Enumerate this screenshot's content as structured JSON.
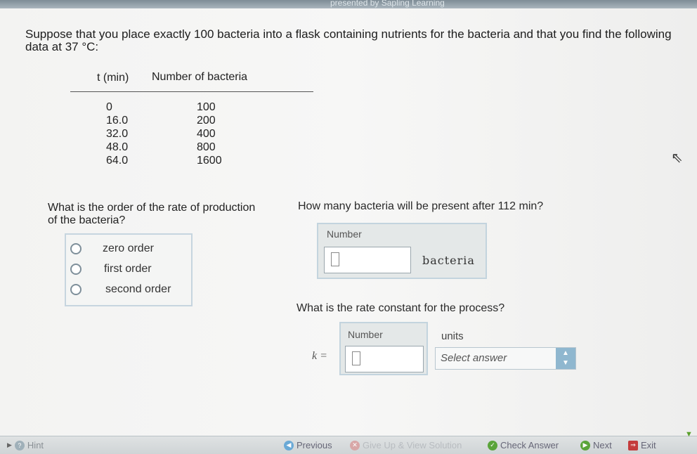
{
  "header": {
    "brand": "presented by Sapling Learning"
  },
  "question": "Suppose that you place exactly 100 bacteria into a flask containing nutrients for the bacteria and that you find the following data at 37 °C:",
  "table": {
    "headers": [
      "t (min)",
      "Number of bacteria"
    ],
    "rows": [
      [
        "0",
        "100"
      ],
      [
        "16.0",
        "200"
      ],
      [
        "32.0",
        "400"
      ],
      [
        "48.0",
        "800"
      ],
      [
        "64.0",
        "1600"
      ]
    ]
  },
  "part1": {
    "question": "What is the order of the rate of production of the bacteria?",
    "options": [
      "zero order",
      "first order",
      "second order"
    ]
  },
  "part2": {
    "question": "How many bacteria will be present after 112 min?",
    "input_label": "Number",
    "input_value": "",
    "unit": "bacteria"
  },
  "part3": {
    "question": "What is the rate constant for the process?",
    "k_label": "k =",
    "input_label": "Number",
    "input_value": "",
    "units_label": "units",
    "units_select": "Select answer"
  },
  "footer": {
    "hint": "Hint",
    "previous": "Previous",
    "give_up": "Give Up & View Solution",
    "check": "Check Answer",
    "next": "Next",
    "exit": "Exit"
  },
  "colors": {
    "radio_border": "#7e8f9a",
    "box_border": "#c3d4de",
    "select_arrow": "#8fb7cf"
  }
}
